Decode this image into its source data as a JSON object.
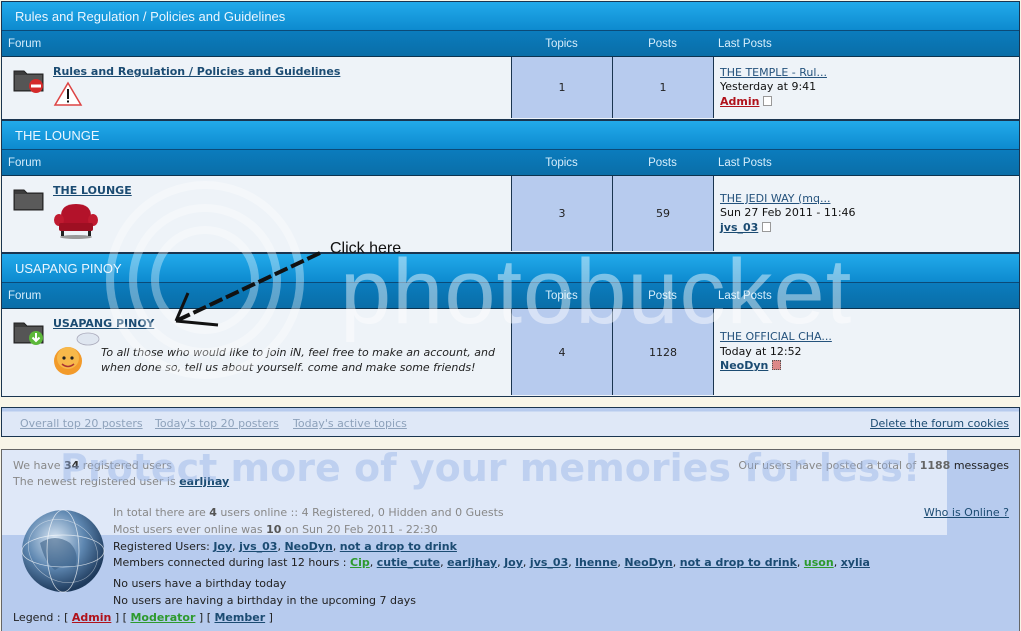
{
  "categories": [
    {
      "title": "Rules and Regulation / Policies and Guidelines",
      "headers": {
        "forum": "Forum",
        "topics": "Topics",
        "posts": "Posts",
        "last": "Last Posts"
      },
      "forum": {
        "name": "Rules and Regulation / Policies and Guidelines",
        "status_icon": "folder-locked-icon",
        "image_icon": "warning-triangle-icon",
        "description": "",
        "topics": "1",
        "posts": "1",
        "last_post": {
          "title": "THE TEMPLE - Rul...",
          "time": "Yesterday at 9:41",
          "user": "Admin",
          "user_role": "admin"
        }
      }
    },
    {
      "title": "THE LOUNGE",
      "headers": {
        "forum": "Forum",
        "topics": "Topics",
        "posts": "Posts",
        "last": "Last Posts"
      },
      "forum": {
        "name": "THE LOUNGE",
        "status_icon": "folder-icon",
        "image_icon": "armchair-icon",
        "description": "",
        "topics": "3",
        "posts": "59",
        "last_post": {
          "title": "THE JEDI WAY (mq...",
          "time": "Sun 27 Feb 2011 - 11:46",
          "user": "jvs_03",
          "user_role": "member"
        }
      }
    },
    {
      "title": "USAPANG PINOY",
      "headers": {
        "forum": "Forum",
        "topics": "Topics",
        "posts": "Posts",
        "last": "Last Posts"
      },
      "forum": {
        "name": "USAPANG PINOY",
        "status_icon": "folder-new-posts-icon",
        "image_icon": "smiley-chat-icon",
        "description": "To all those who would like to join iN, feel free to make an account, and when done so, tell us about yourself. come and make some friends!",
        "topics": "4",
        "posts": "1128",
        "last_post": {
          "title": "THE OFFICIAL CHA...",
          "time": "Today at 12:52",
          "user": "NeoDyn",
          "user_role": "member"
        }
      }
    }
  ],
  "annotation": {
    "label": "Click here"
  },
  "watermark": {
    "main": "photobucket",
    "tagline": "Protect more of your memories for less!"
  },
  "links": {
    "overall_top": "Overall top 20 posters",
    "today_top": "Today's top 20 posters",
    "active_topics": "Today's active topics",
    "delete_cookies": "Delete the forum cookies"
  },
  "stats": {
    "registered_prefix": "We have ",
    "registered_count": "34",
    "registered_suffix": " registered users",
    "newest_prefix": "The newest registered user is ",
    "newest_user": "earljhay",
    "total_prefix": "Our users have posted a total of ",
    "total_messages": "1188",
    "total_suffix": " messages",
    "online_prefix": "In total there are ",
    "online_count": "4",
    "online_suffix": " users online :: 4 Registered, 0 Hidden and 0 Guests",
    "who_online": "Who is Online ?",
    "most_prefix": "Most users ever online was ",
    "most_count": "10",
    "most_suffix": " on Sun 20 Feb 2011 - 22:30",
    "registered_users_label": "Registered Users: ",
    "registered_users": [
      {
        "name": "Joy",
        "role": "member"
      },
      {
        "name": "jvs_03",
        "role": "member"
      },
      {
        "name": "NeoDyn",
        "role": "member"
      },
      {
        "name": "not a drop to drink",
        "role": "member"
      }
    ],
    "connected_label": "Members connected during last 12 hours : ",
    "connected_users": [
      {
        "name": "Cip",
        "role": "mod"
      },
      {
        "name": "cutie_cute",
        "role": "member"
      },
      {
        "name": "earljhay",
        "role": "member"
      },
      {
        "name": "Joy",
        "role": "member"
      },
      {
        "name": "jvs_03",
        "role": "member"
      },
      {
        "name": "lhenne",
        "role": "member"
      },
      {
        "name": "NeoDyn",
        "role": "member"
      },
      {
        "name": "not a drop to drink",
        "role": "member"
      },
      {
        "name": "uson",
        "role": "mod"
      },
      {
        "name": "xylia",
        "role": "member"
      }
    ],
    "birthday_today": "No users have a birthday today",
    "birthday_upcoming": "No users are having a birthday in the upcoming 7 days",
    "legend_label": "Legend : ",
    "legend": [
      {
        "name": "Admin",
        "role": "admin"
      },
      {
        "name": "Moderator",
        "role": "mod"
      },
      {
        "name": "Member",
        "role": "member"
      }
    ]
  },
  "colors": {
    "category_title": "#1aa0e2",
    "header_bar": "#0a74b2",
    "count_cell": "#b7cbee",
    "admin": "#b0121b",
    "moderator": "#2d9a2d",
    "member": "#1b4b72"
  }
}
